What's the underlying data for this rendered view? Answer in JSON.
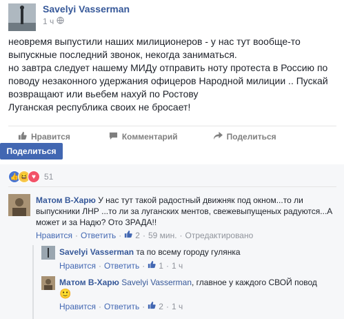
{
  "post": {
    "author": "Savelyi Vasserman",
    "time": "1 ч",
    "body": "неовремя выпустили наших милиционеров - у нас тут вообще-то\nвыпускные последний звонок, некогда заниматься.\nно завтра следует нашему МИДу отправить ноту протеста в Россию по\nповоду незаконного удержания офицеров Народной милиции .. Пускай\nвозвращают или вьебем нахуй по Ростову\nЛуганская республика своих не бросает!"
  },
  "actions": {
    "like": "Нравится",
    "comment": "Комментарий",
    "share": "Поделиться"
  },
  "share_button": "Поделиться",
  "reactions": {
    "count": "51"
  },
  "comments": [
    {
      "author": "Матом В-Харю",
      "text": "У нас тут такой радостный движняк под окном...то ли выпускники ЛНР ...то ли за луганских ментов, свежевыпущеных радуются...А может и за Надю? Ото ЗРАДА!!",
      "like": "Нравится",
      "reply": "Ответить",
      "likes": "2",
      "time": "59 мин.",
      "edited": "Отредактировано"
    },
    {
      "author": "Savelyi Vasserman",
      "text": "та по всему городу гулянка",
      "like": "Нравится",
      "reply": "Ответить",
      "likes": "1",
      "time": "1 ч"
    },
    {
      "author": "Матом В-Харю",
      "mention": "Savelyi Vasserman",
      "text": ", главное у каждого СВОЙ повод",
      "emoji": "🙂",
      "like": "Нравится",
      "reply": "Ответить",
      "likes": "2",
      "time": "1 ч"
    }
  ],
  "colors": {
    "link": "#365899",
    "button": "#4267b2",
    "muted": "#90949c"
  }
}
